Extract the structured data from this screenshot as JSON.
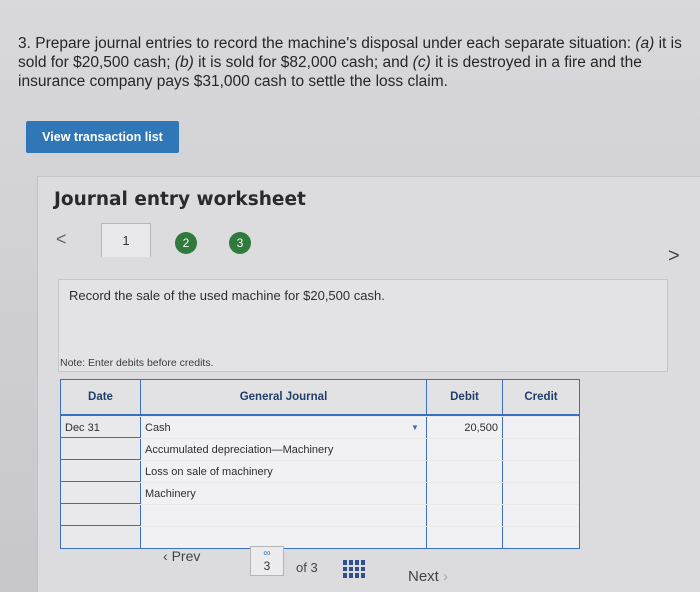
{
  "question": {
    "number": "3.",
    "intro": "Prepare journal entries to record the machine's disposal under each separate situation:",
    "part_a_label": "(a)",
    "part_a": "it is sold for $20,500 cash;",
    "part_b_label": "(b)",
    "part_b": "it is sold for $82,000 cash; and",
    "part_c_label": "(c)",
    "part_c": "it is destroyed in a fire and the insurance company pays $31,000 cash to settle the loss claim."
  },
  "view_transaction_button": "View transaction list",
  "worksheet": {
    "title": "Journal entry worksheet",
    "nav_left": "<",
    "nav_right": ">",
    "tabs": [
      "1",
      "2",
      "3"
    ],
    "instruction": "Record the sale of the used machine for $20,500 cash.",
    "note": "Note: Enter debits before credits."
  },
  "journal": {
    "headers": {
      "date": "Date",
      "general_journal": "General Journal",
      "debit": "Debit",
      "credit": "Credit"
    },
    "rows": [
      {
        "date": "Dec 31",
        "account": "Cash",
        "debit": "20,500",
        "credit": ""
      },
      {
        "date": "",
        "account": "Accumulated depreciation—Machinery",
        "debit": "",
        "credit": ""
      },
      {
        "date": "",
        "account": "Loss on sale of machinery",
        "debit": "",
        "credit": ""
      },
      {
        "date": "",
        "account": "Machinery",
        "debit": "",
        "credit": ""
      },
      {
        "date": "",
        "account": "",
        "debit": "",
        "credit": ""
      },
      {
        "date": "",
        "account": "",
        "debit": "",
        "credit": ""
      }
    ]
  },
  "pagination": {
    "prev": "Prev",
    "current_page": "3",
    "of_text": "of 3",
    "next": "Next"
  },
  "colors": {
    "accent": "#2f77b7",
    "tab_green": "#2f7a3c",
    "grid_blue": "#3b6fc0"
  }
}
